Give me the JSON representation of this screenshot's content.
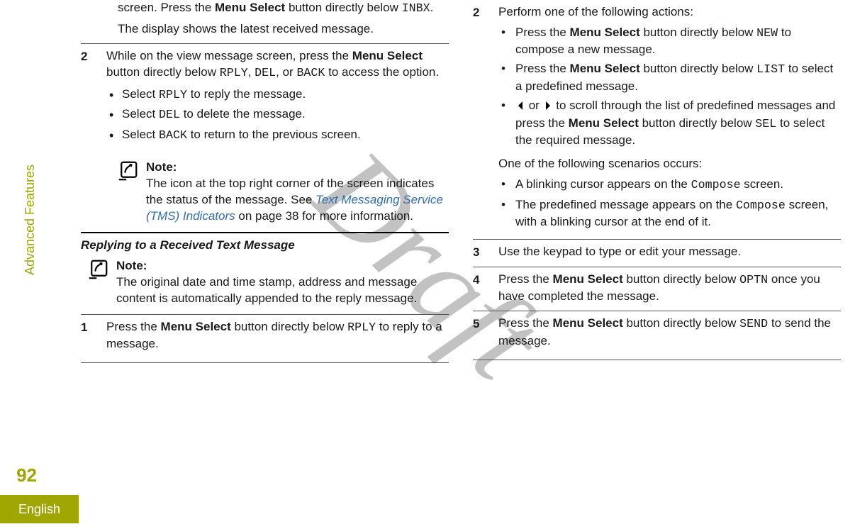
{
  "watermark": "Draft",
  "sidebar": {
    "section_label": "Advanced Features",
    "page_number": "92",
    "language": "English"
  },
  "col1": {
    "intro_cont_prefix": "screen. Press the ",
    "intro_cont_bold": "Menu Select",
    "intro_cont_mid": " button directly below ",
    "intro_cont_mono": "INBX",
    "intro_cont_end": ".",
    "intro_result": "The display shows the latest received message.",
    "step2": {
      "num": "2",
      "p_prefix": "While on the view message screen, press the ",
      "p_bold": "Menu Select",
      "p_mid": " button directly below ",
      "p_m1": "RPLY",
      "p_c1": ", ",
      "p_m2": "DEL",
      "p_c2": ", or ",
      "p_m3": "BACK",
      "p_end": " to access the option.",
      "b1a": "Select ",
      "b1m": "RPLY",
      "b1b": " to reply the message.",
      "b2a": "Select ",
      "b2m": "DEL",
      "b2b": " to delete the message.",
      "b3a": "Select ",
      "b3m": "BACK",
      "b3b": " to return to the previous screen."
    },
    "note1": {
      "title": "Note:",
      "txt_a": "The icon at the top right corner of the screen indicates the status of the message. See ",
      "txt_link": "Text Messaging Service (TMS) Indicators",
      "txt_b": " on page 38 for more information."
    },
    "section_heading": "Replying to a Received Text Message",
    "note2": {
      "title": "Note:",
      "txt": "The original date and time stamp, address and message content is automatically appended to the reply message."
    },
    "r_step1": {
      "num": "1",
      "p_a": "Press the ",
      "p_bold": "Menu Select",
      "p_b": " button directly below ",
      "p_m": "RPLY",
      "p_c": " to reply to a message."
    }
  },
  "col2": {
    "step2": {
      "num": "2",
      "lead": "Perform one of the following actions:",
      "b1_a": "Press the ",
      "b1_bold": "Menu Select",
      "b1_b": " button directly below ",
      "b1_m": "NEW",
      "b1_c": " to compose a new message.",
      "b2_a": "Press the ",
      "b2_bold": "Menu Select",
      "b2_b": " button directly below ",
      "b2_m": "LIST",
      "b2_c": " to select a predefined message.",
      "b3_a": " or ",
      "b3_b": " to scroll through the list of predefined messages and press the ",
      "b3_bold": "Menu Select",
      "b3_c": " button directly below ",
      "b3_m": "SEL",
      "b3_d": " to select the required message.",
      "scenario_lead": "One of the following scenarios occurs:",
      "s1_a": "A blinking cursor appears on the ",
      "s1_m": "Compose",
      "s1_b": " screen.",
      "s2_a": "The predefined message appears on the ",
      "s2_m": "Compose",
      "s2_b": " screen, with a blinking cursor at the end of it."
    },
    "step3": {
      "num": "3",
      "text": "Use the keypad to type or edit your message."
    },
    "step4": {
      "num": "4",
      "p_a": "Press the ",
      "p_bold": "Menu Select",
      "p_b": " button directly below ",
      "p_m": "OPTN",
      "p_c": " once you have completed the message."
    },
    "step5": {
      "num": "5",
      "p_a": "Press the ",
      "p_bold": "Menu Select",
      "p_b": " button directly below ",
      "p_m": "SEND",
      "p_c": " to send the message."
    }
  }
}
